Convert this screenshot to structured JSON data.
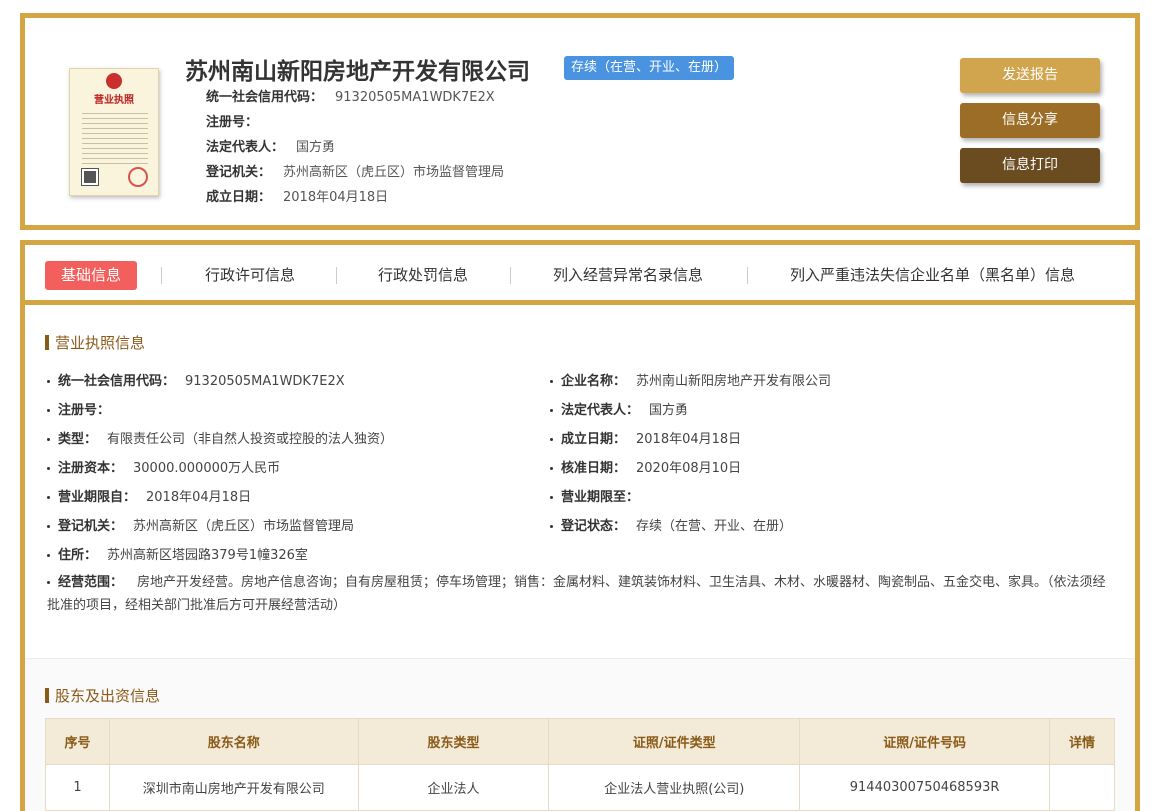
{
  "header": {
    "company_name": "苏州南山新阳房地产开发有限公司",
    "status": "存续（在营、开业、在册）",
    "license_image": {
      "title": "营业执照",
      "alt": "营业执照"
    },
    "fields": [
      {
        "label": "统一社会信用代码：",
        "value": "91320505MA1WDK7E2X"
      },
      {
        "label": "注册号：",
        "value": ""
      },
      {
        "label": "法定代表人：",
        "value": "国方勇"
      },
      {
        "label": "登记机关：",
        "value": "苏州高新区（虎丘区）市场监督管理局"
      },
      {
        "label": "成立日期：",
        "value": "2018年04月18日"
      }
    ],
    "buttons": {
      "send": "发送报告",
      "share": "信息分享",
      "print": "信息打印"
    }
  },
  "tabs": [
    {
      "label": "基础信息",
      "active": true
    },
    {
      "label": "行政许可信息",
      "active": false
    },
    {
      "label": "行政处罚信息",
      "active": false
    },
    {
      "label": "列入经营异常名录信息",
      "active": false
    },
    {
      "label": "列入严重违法失信企业名单（黑名单）信息",
      "active": false
    }
  ],
  "license_section": {
    "title": "营业执照信息",
    "left": [
      {
        "label": "统一社会信用代码：",
        "value": "91320505MA1WDK7E2X"
      },
      {
        "label": "注册号：",
        "value": ""
      },
      {
        "label": "类型：",
        "value": "有限责任公司（非自然人投资或控股的法人独资）"
      },
      {
        "label": "注册资本：",
        "value": "30000.000000万人民币"
      },
      {
        "label": "营业期限自：",
        "value": "2018年04月18日"
      },
      {
        "label": "登记机关：",
        "value": "苏州高新区（虎丘区）市场监督管理局"
      },
      {
        "label": "住所：",
        "value": "苏州高新区塔园路379号1幢326室"
      }
    ],
    "right": [
      {
        "label": "企业名称：",
        "value": "苏州南山新阳房地产开发有限公司"
      },
      {
        "label": "法定代表人：",
        "value": "国方勇"
      },
      {
        "label": "成立日期：",
        "value": "2018年04月18日"
      },
      {
        "label": "核准日期：",
        "value": "2020年08月10日"
      },
      {
        "label": "营业期限至：",
        "value": ""
      },
      {
        "label": "登记状态：",
        "value": "存续（在营、开业、在册）"
      }
    ],
    "scope": {
      "label": "经营范围：",
      "value": "房地产开发经营。房地产信息咨询；自有房屋租赁；停车场管理；销售：金属材料、建筑装饰材料、卫生洁具、木材、水暖器材、陶瓷制品、五金交电、家具。（依法须经批准的项目，经相关部门批准后方可开展经营活动）"
    }
  },
  "shareholder_section": {
    "title": "股东及出资信息",
    "columns": [
      "序号",
      "股东名称",
      "股东类型",
      "证照/证件类型",
      "证照/证件号码",
      "详情"
    ],
    "rows": [
      [
        "1",
        "深圳市南山房地产开发有限公司",
        "企业法人",
        "企业法人营业执照(公司)",
        "91440300750468593R",
        ""
      ]
    ]
  }
}
